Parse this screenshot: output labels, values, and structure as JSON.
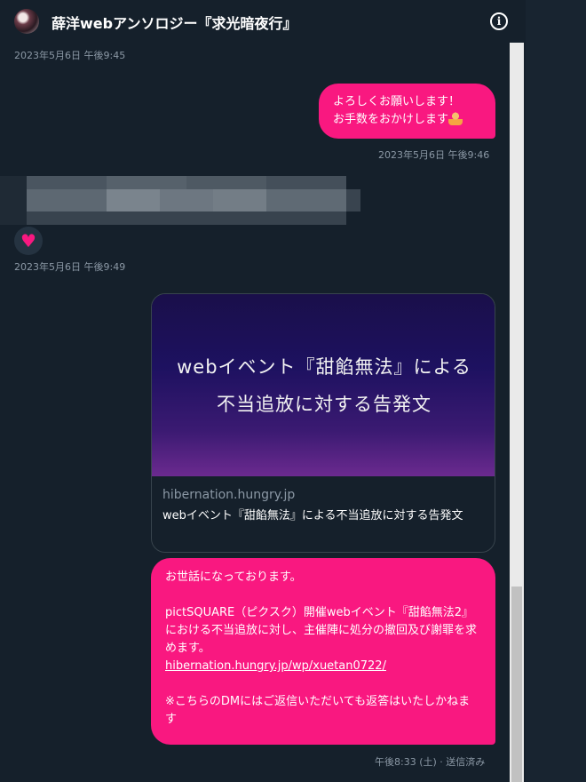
{
  "header": {
    "title": "薛洋webアンソロジー『求光暗夜行』",
    "info_glyph": "i"
  },
  "messages": {
    "ts1": "2023年5月6日 午後9:45",
    "bubble1_line1": "よろしくお願いします！",
    "bubble1_line2": "お手数をおかけします",
    "ts2": "2023年5月6日 午後9:46",
    "reaction": "♥",
    "ts3": "2023年5月6日 午後9:49",
    "card": {
      "image_line1": "webイベント『甜餡無法』による",
      "image_line2": "不当追放に対する告発文",
      "domain": "hibernation.hungry.jp",
      "title": "webイベント『甜餡無法』による不当追放に対する告発文"
    },
    "bubble2": {
      "line1": "お世話になっております。",
      "line2": "pictSQUARE（ピクスク）開催webイベント『甜餡無法2』における不当追放に対し、主催陣に処分の撤回及び謝罪を求めます。",
      "link": "hibernation.hungry.jp/wp/xuetan0722/",
      "line3": "※こちらのDMにはご返信いただいても返答はいたしかねます"
    },
    "ts4": "午後8:33 (土) · 送信済み"
  },
  "colors": {
    "background": "#15202b",
    "accent_pink": "#f91880",
    "muted_text": "#8b98a5"
  },
  "icons": [
    "info-icon",
    "heart-icon",
    "person-bowing-emoji"
  ]
}
